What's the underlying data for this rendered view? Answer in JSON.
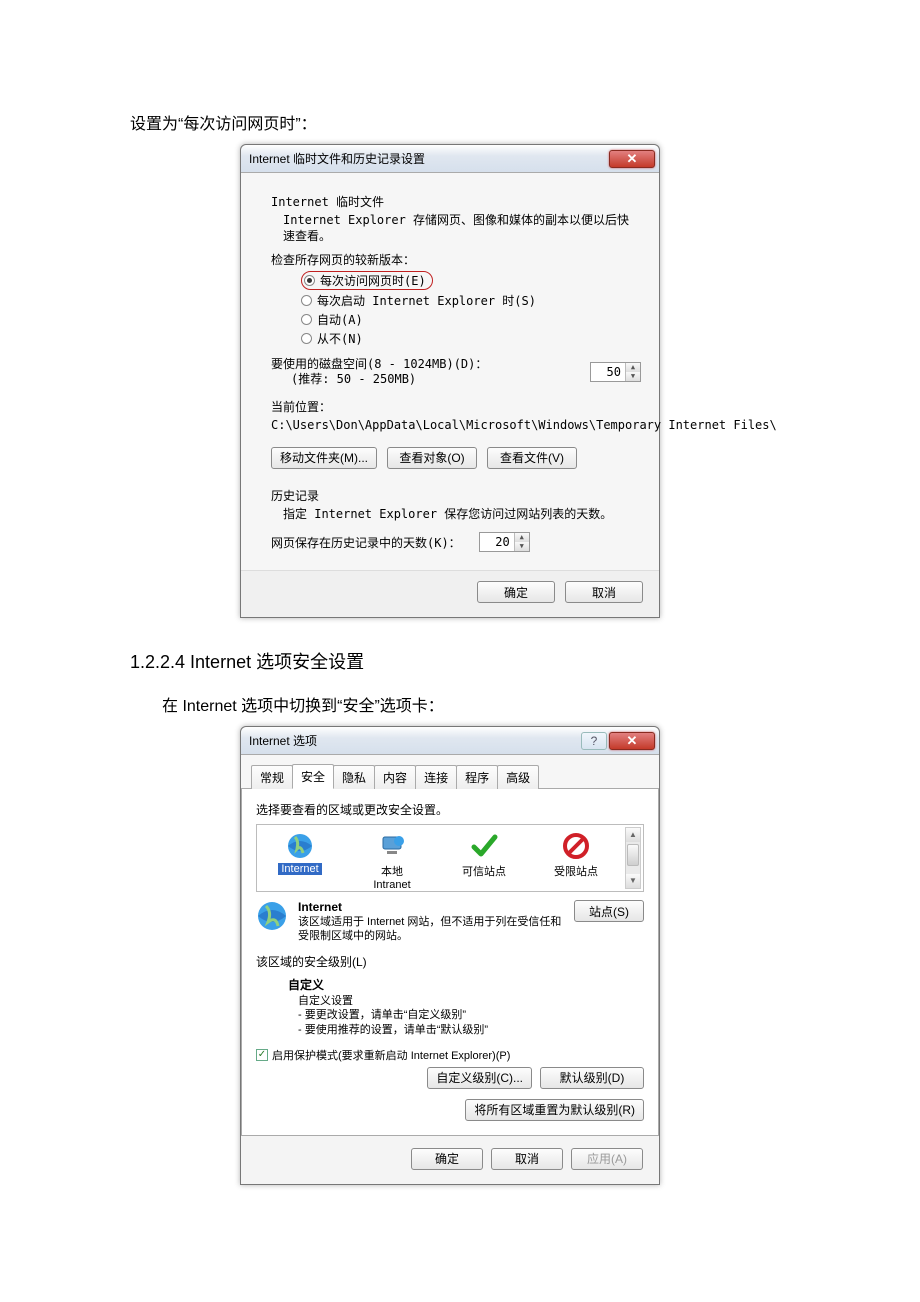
{
  "doc": {
    "intro_line": "设置为“每次访问网页时”：",
    "section_heading": "1.2.2.4 Internet 选项安全设置",
    "switch_line": "在 Internet 选项中切换到“安全”选项卡："
  },
  "dialog1": {
    "title": "Internet 临时文件和历史记录设置",
    "group_temp_title": "Internet 临时文件",
    "group_temp_desc": "Internet Explorer 存储网页、图像和媒体的副本以便以后快速查看。",
    "check_newer_label": "检查所存网页的较新版本：",
    "radio_every_visit": "每次访问网页时(E)",
    "radio_every_start": "每次启动 Internet Explorer 时(S)",
    "radio_auto": "自动(A)",
    "radio_never": "从不(N)",
    "disk_label": "要使用的磁盘空间(8 - 1024MB)(D)：",
    "disk_recommend": "(推荐: 50 - 250MB)",
    "disk_value": "50",
    "cur_loc_label": "当前位置：",
    "cur_loc_path": "C:\\Users\\Don\\AppData\\Local\\Microsoft\\Windows\\Temporary Internet Files\\",
    "btn_move": "移动文件夹(M)...",
    "btn_view_obj": "查看对象(O)",
    "btn_view_files": "查看文件(V)",
    "history_title": "历史记录",
    "history_desc": "指定 Internet Explorer 保存您访问过网站列表的天数。",
    "history_days_label": "网页保存在历史记录中的天数(K)：",
    "history_days_value": "20",
    "btn_ok": "确定",
    "btn_cancel": "取消"
  },
  "dialog2": {
    "title": "Internet 选项",
    "tabs": [
      "常规",
      "安全",
      "隐私",
      "内容",
      "连接",
      "程序",
      "高级"
    ],
    "active_tab_index": 1,
    "zone_prompt": "选择要查看的区域或更改安全设置。",
    "zones": [
      {
        "label": "Internet",
        "sub": ""
      },
      {
        "label": "本地",
        "sub": "Intranet"
      },
      {
        "label": "可信站点",
        "sub": ""
      },
      {
        "label": "受限站点",
        "sub": ""
      }
    ],
    "zone_detail_name": "Internet",
    "zone_detail_desc": "该区域适用于 Internet 网站，但不适用于列在受信任和受限制区域中的网站。",
    "btn_sites": "站点(S)",
    "sec_level_title": "该区域的安全级别(L)",
    "custom_title": "自定义",
    "custom_sub": "自定义设置",
    "custom_line1": "- 要更改设置，请单击“自定义级别”",
    "custom_line2": "- 要使用推荐的设置，请单击“默认级别”",
    "protect_mode": "启用保护模式(要求重新启动 Internet Explorer)(P)",
    "btn_custom_level": "自定义级别(C)...",
    "btn_default_level": "默认级别(D)",
    "btn_reset_all": "将所有区域重置为默认级别(R)",
    "btn_ok": "确定",
    "btn_cancel": "取消",
    "btn_apply": "应用(A)"
  }
}
